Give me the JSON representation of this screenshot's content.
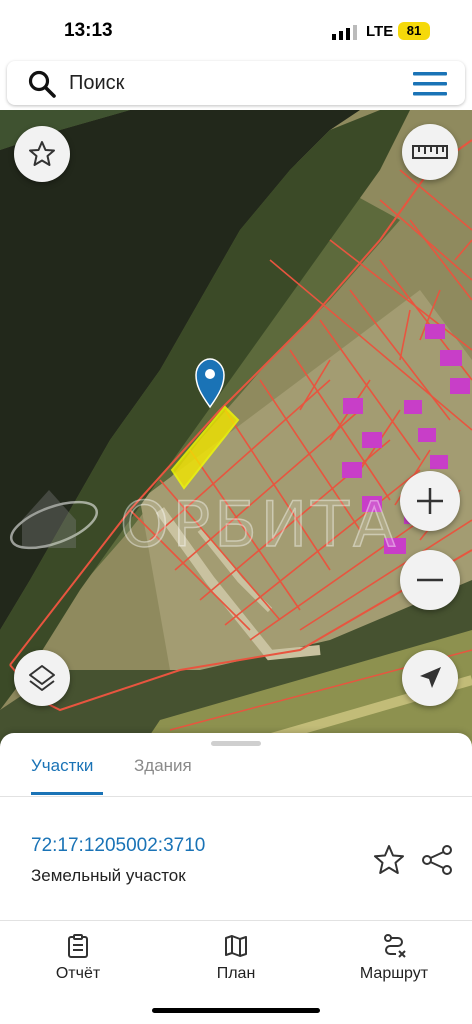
{
  "status_bar": {
    "time": "13:13",
    "network": "LTE",
    "battery": "81"
  },
  "search": {
    "placeholder": "Поиск",
    "search_icon": "search-icon",
    "menu_icon": "menu-icon"
  },
  "map": {
    "watermark": "ОРБИТА",
    "buttons": [
      "star-icon",
      "ruler-icon",
      "zoom-in-icon",
      "zoom-out-icon",
      "layers-icon",
      "location-arrow-icon"
    ],
    "colors": {
      "parcel_border": "#e8553f",
      "selected_parcel": "#f2e600",
      "building": "#c83ec8",
      "marker": "#1a73b6"
    }
  },
  "sheet": {
    "tabs": [
      {
        "label": "Участки",
        "active": true
      },
      {
        "label": "Здания",
        "active": false
      }
    ],
    "parcel": {
      "cadastral_number": "72:17:1205002:3710",
      "type": "Земельный участок"
    }
  },
  "bottom_nav": [
    {
      "label": "Отчёт",
      "icon": "report-icon"
    },
    {
      "label": "План",
      "icon": "map-plan-icon"
    },
    {
      "label": "Маршрут",
      "icon": "route-icon"
    }
  ],
  "accent_color": "#1a73b6"
}
